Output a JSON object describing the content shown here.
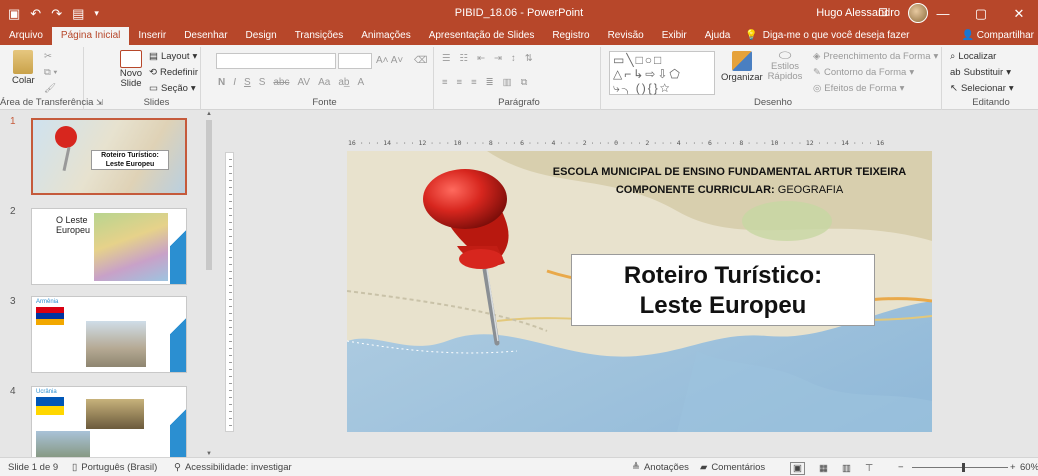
{
  "window": {
    "title": "PIBID_18.06 - PowerPoint",
    "user": "Hugo Alessandro",
    "controls": [
      "—",
      "▢",
      "✕"
    ]
  },
  "tabs": [
    "Arquivo",
    "Página Inicial",
    "Inserir",
    "Desenhar",
    "Design",
    "Transições",
    "Animações",
    "Apresentação de Slides",
    "Registro",
    "Revisão",
    "Exibir",
    "Ajuda"
  ],
  "active_tab": "Página Inicial",
  "tell_me": "Diga-me o que você deseja fazer",
  "share": "Compartilhar",
  "ribbon": {
    "clipboard": {
      "label": "Área de Transferência",
      "paste": "Colar"
    },
    "slides": {
      "label": "Slides",
      "new_slide": "Novo Slide",
      "layout": "Layout",
      "reset": "Redefinir",
      "section": "Seção"
    },
    "font": {
      "label": "Fonte",
      "buttons": [
        "N",
        "I",
        "S",
        "S",
        "abc",
        "AV",
        "Aa",
        "A"
      ]
    },
    "paragraph": {
      "label": "Parágrafo"
    },
    "drawing": {
      "label": "Desenho",
      "arrange": "Organizar",
      "quick_styles": "Estilos Rápidos",
      "fill": "Preenchimento da Forma",
      "outline": "Contorno da Forma",
      "effects": "Efeitos de Forma"
    },
    "editing": {
      "label": "Editando",
      "find": "Localizar",
      "replace": "Substituir",
      "select": "Selecionar"
    }
  },
  "ruler_text": "16 · · · 14 · · · 12 · · · 10 · · · 8 · · · 6 · · · 4 · · · 2 · · · 0 · · · 2 · · · 4 · · · 6 · · · 8 · · · 10 · · · 12 · · · 14 · · · 16",
  "thumbnails": [
    {
      "num": "1",
      "title": "Roteiro Turístico: Leste Europeu",
      "selected": true
    },
    {
      "num": "2",
      "title": "O Leste Europeu"
    },
    {
      "num": "3",
      "title": "Armênia"
    },
    {
      "num": "4",
      "title": "Ucrânia"
    }
  ],
  "slide": {
    "school": "ESCOLA MUNICIPAL DE ENSINO FUNDAMENTAL ARTUR TEIXEIRA",
    "component_label": "COMPONENTE CURRICULAR:",
    "component_value": "GEOGRAFIA",
    "title_line1": "Roteiro Turístico:",
    "title_line2": "Leste Europeu"
  },
  "status": {
    "slide_info": "Slide 1 de 9",
    "language": "Português (Brasil)",
    "accessibility": "Acessibilidade: investigar",
    "notes": "Anotações",
    "comments": "Comentários",
    "zoom": "60%"
  },
  "colors": {
    "accent": "#b7472a",
    "ribbon": "#f3f3f3",
    "pin": "#d7261e"
  }
}
